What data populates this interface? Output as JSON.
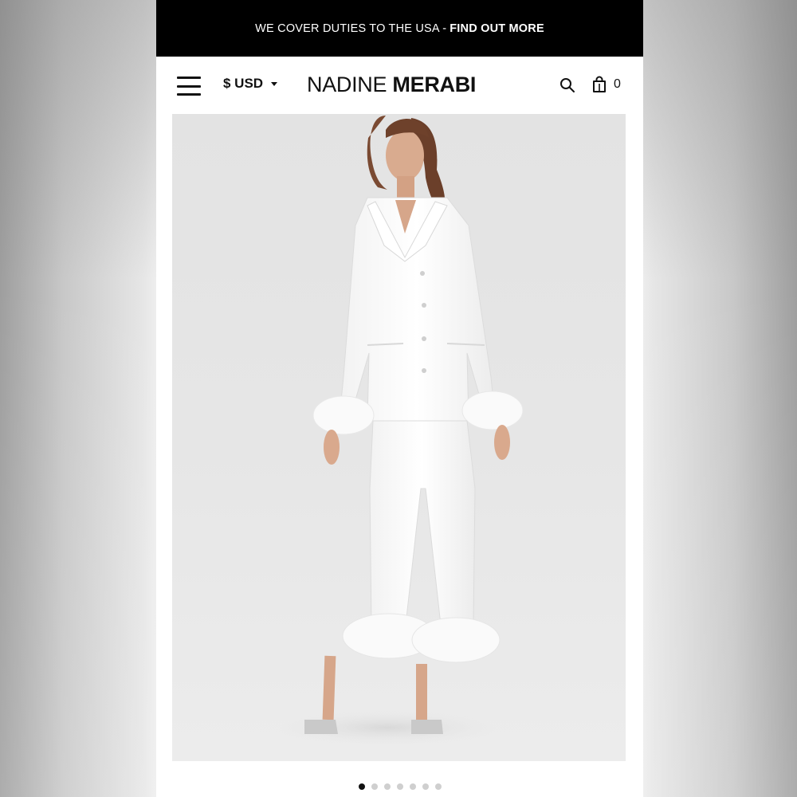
{
  "promo_bar": {
    "text": "WE COVER DUTIES TO THE USA - ",
    "link": "FIND OUT MORE"
  },
  "header": {
    "menu_icon": "hamburger-menu-icon",
    "currency": "$ USD",
    "brand": {
      "light": "NADINE ",
      "bold": "MERABI"
    },
    "search_icon": "search-icon",
    "cart_icon": "shopping-bag-icon",
    "cart_count": "0"
  },
  "gallery": {
    "image_subject": "model-in-white-satin-feather-trim-pajama-set",
    "slide_count": 7,
    "active_slide": 1
  },
  "colors": {
    "promo_bg": "#000000",
    "promo_text": "#ffffff",
    "text": "#111111",
    "dot_active": "#111111",
    "dot_inactive": "#cfcfcf"
  }
}
